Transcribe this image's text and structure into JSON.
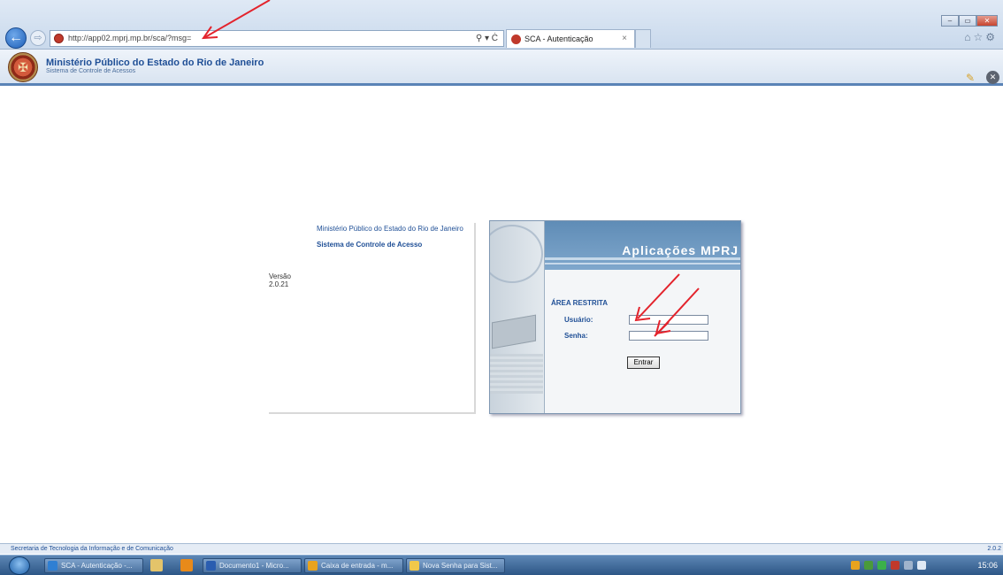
{
  "browser": {
    "back_glyph": "←",
    "forward_glyph": "⇨",
    "url": "http://app02.mprj.mp.br/sca/?msg=",
    "addr_tools": "⚲ ▾ Ċ",
    "tab_title": "SCA - Autenticação",
    "tab_close": "×",
    "window_buttons": [
      "–",
      "▭",
      "✕"
    ],
    "toolbar_icons": "⌂☆⚙"
  },
  "header": {
    "org_name": "Ministério Público do Estado do Rio de Janeiro",
    "subtitle": "Sistema de Controle de Acessos"
  },
  "info": {
    "org": "Ministério Público do Estado do Rio de Janeiro",
    "system": "Sistema de Controle de Acesso",
    "version_label": "Versão",
    "version": "2.0.21"
  },
  "login": {
    "title": "Aplicações MPRJ",
    "area": "ÁREA RESTRITA",
    "user_label": "Usuário:",
    "password_label": "Senha:",
    "user_value": "",
    "password_value": "",
    "submit_label": "Entrar"
  },
  "footer": {
    "text": "Secretaria de Tecnologia da Informação e de Comunicação",
    "version": "2.0.2"
  },
  "taskbar": {
    "tasks": [
      {
        "label": "SCA - Autenticação -...",
        "color": "#2f7fd3"
      },
      {
        "label": "Documento1 - Micro...",
        "color": "#2a5db0"
      },
      {
        "label": "Caixa de entrada - m...",
        "color": "#e8a31e"
      },
      {
        "label": "Nova Senha para Sist...",
        "color": "#f1c84a"
      }
    ],
    "clock": "15:06"
  },
  "colors": {
    "brand_blue": "#1f4f96",
    "arrow_red": "#e3232c"
  }
}
